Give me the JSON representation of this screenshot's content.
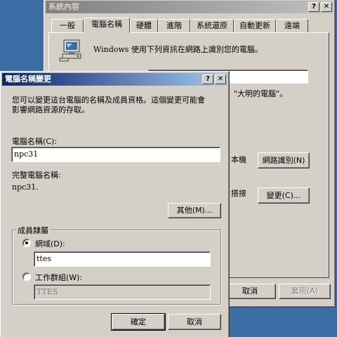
{
  "back_window": {
    "title": "系統內容",
    "tabs": [
      "一般",
      "電腦名稱",
      "硬體",
      "進階",
      "系統還原",
      "自動更新",
      "遠端"
    ],
    "description": "Windows 使用下列資訊在網路上識別您的電腦。",
    "example_text": "\"大明的電腦\"。",
    "local_label": "本機",
    "connect_label": "搭接",
    "network_id_button": "網路識別(N)",
    "change_button": "變更(C)...",
    "cancel_button": "取消",
    "apply_button": "套用(A)"
  },
  "dialog": {
    "title": "電腦名稱變更",
    "intro": [
      "您可以變更這台電腦的名稱及成員資格。這個變更可能會",
      "影響網路資源的存取。"
    ],
    "computer_name_label": "電腦名稱(C):",
    "computer_name_value": "npc31",
    "full_name_label": "完整電腦名稱:",
    "full_name_value": "npc31.",
    "more_button": "其他(M)...",
    "member_group_label": "成員隸屬",
    "domain_label": "網域(D):",
    "domain_value": "ttes",
    "workgroup_label": "工作群組(W):",
    "workgroup_value": "TTES",
    "ok_button": "確定",
    "cancel_button": "取消"
  },
  "selected": {
    "tab": "電腦名稱",
    "membership": "domain"
  }
}
